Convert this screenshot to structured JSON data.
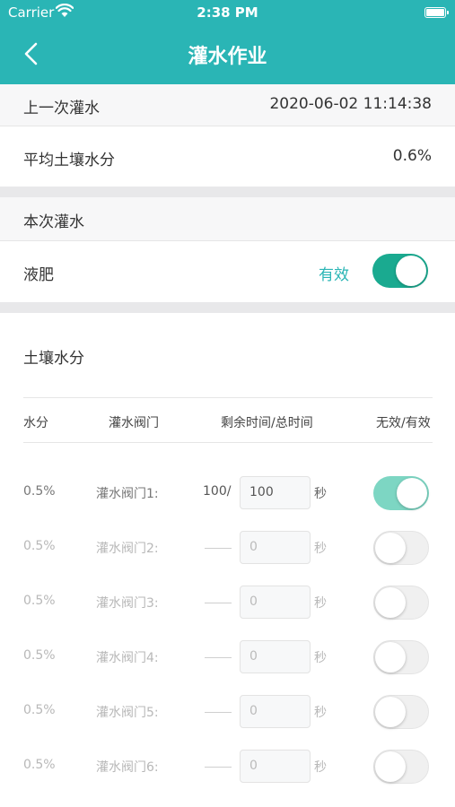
{
  "status_bar": {
    "carrier": "Carrier",
    "time": "2:38 PM"
  },
  "nav": {
    "title": "灌水作业",
    "back_icon": "chevron-left-icon"
  },
  "last_irrigation": {
    "label": "上一次灌水",
    "value": "2020-06-02 11:14:38"
  },
  "avg_soil_moisture": {
    "label": "平均土壤水分",
    "value": "0.6%"
  },
  "current_irrigation": {
    "label": "本次灌水"
  },
  "liquid_fertilizer": {
    "label": "液肥",
    "status": "有效",
    "toggle_on": true
  },
  "soil_moisture": {
    "title": "土壤水分"
  },
  "table": {
    "headers": [
      "水分",
      "灌水阀门",
      "剩余时间/总时间",
      "无效/有效"
    ],
    "rows": [
      {
        "moisture": "0.5%",
        "valve": "灌水阀门1:",
        "remaining": "100/",
        "total": "100",
        "unit": "秒",
        "enabled": true
      },
      {
        "moisture": "0.5%",
        "valve": "灌水阀门2:",
        "remaining": "",
        "total": "0",
        "unit": "秒",
        "enabled": false
      },
      {
        "moisture": "0.5%",
        "valve": "灌水阀门3:",
        "remaining": "",
        "total": "0",
        "unit": "秒",
        "enabled": false
      },
      {
        "moisture": "0.5%",
        "valve": "灌水阀门4:",
        "remaining": "",
        "total": "0",
        "unit": "秒",
        "enabled": false
      },
      {
        "moisture": "0.5%",
        "valve": "灌水阀门5:",
        "remaining": "",
        "total": "0",
        "unit": "秒",
        "enabled": false
      },
      {
        "moisture": "0.5%",
        "valve": "灌水阀门6:",
        "remaining": "",
        "total": "0",
        "unit": "秒",
        "enabled": false
      }
    ]
  },
  "colors": {
    "header": "#2ab5b5",
    "accent": "#1aaa90",
    "status_text": "#2ab5b5"
  }
}
